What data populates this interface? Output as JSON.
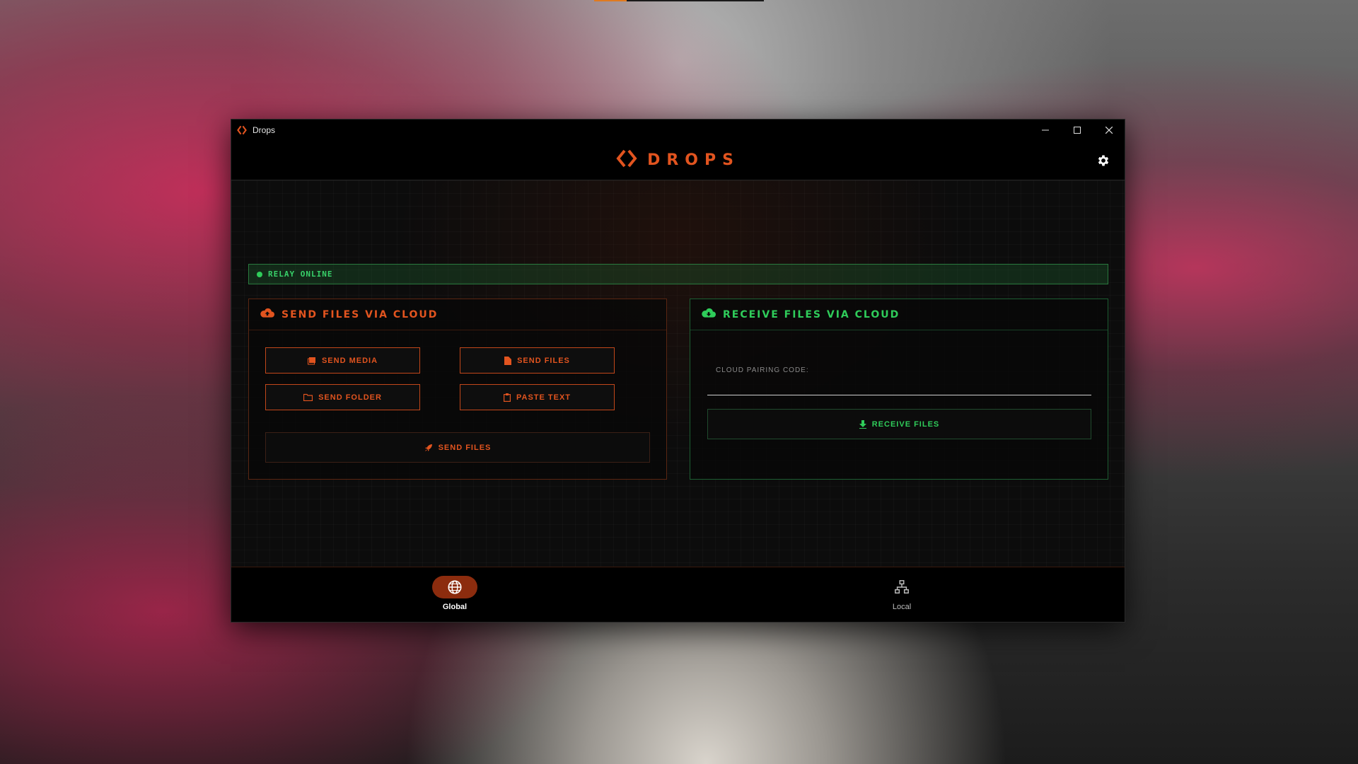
{
  "window": {
    "title": "Drops"
  },
  "header": {
    "brand": "DROPS"
  },
  "status": {
    "relay_text": "RELAY ONLINE",
    "relay_color": "#2fcc5a"
  },
  "send_panel": {
    "title": "SEND FILES VIA CLOUD",
    "buttons": {
      "send_media": "SEND MEDIA",
      "send_files": "SEND FILES",
      "send_folder": "SEND FOLDER",
      "paste_text": "PASTE TEXT",
      "send_files_primary": "SEND FILES"
    }
  },
  "receive_panel": {
    "title": "RECEIVE FILES VIA CLOUD",
    "pairing_label": "CLOUD PAIRING CODE:",
    "pairing_value": "",
    "receive_button": "RECEIVE FILES"
  },
  "nav": {
    "global_label": "Global",
    "local_label": "Local",
    "active": "Global"
  },
  "colors": {
    "accent": "#e2541f",
    "success": "#2fcc5a",
    "nav_active": "#8c2c0e"
  },
  "icons": {
    "app": "drops-logo-icon",
    "settings": "gear-icon",
    "send_cloud": "cloud-upload-icon",
    "receive_cloud": "cloud-download-icon",
    "global": "globe-icon",
    "local": "network-icon"
  }
}
